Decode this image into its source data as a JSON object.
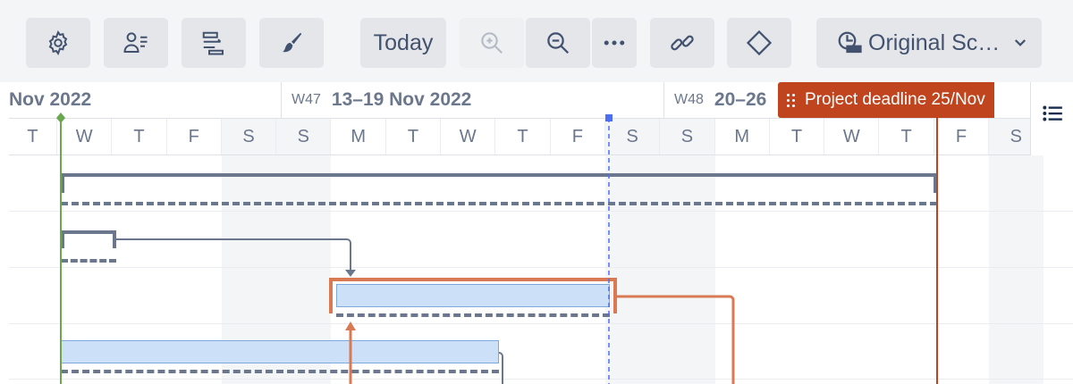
{
  "toolbar": {
    "buttons": [
      {
        "icon": "gear-icon"
      },
      {
        "icon": "user-list-icon"
      },
      {
        "icon": "align-bars-icon"
      },
      {
        "icon": "paint-brush-icon"
      },
      {
        "label": "Today"
      },
      {
        "icon": "zoom-in-icon",
        "disabled": true
      },
      {
        "icon": "zoom-out-icon"
      },
      {
        "icon": "more-icon"
      },
      {
        "icon": "link-icon"
      },
      {
        "icon": "milestone-diamond-icon"
      },
      {
        "label": "Original Sc…",
        "icon": "baseline-icon",
        "dropdown": "chevron-down-icon"
      }
    ]
  },
  "timeline": {
    "weeks": [
      {
        "number": "",
        "label": "Nov 2022"
      },
      {
        "number": "W47",
        "label": "13–19 Nov 2022"
      },
      {
        "number": "W48",
        "label": "20–26"
      }
    ],
    "days": [
      "T",
      "W",
      "T",
      "F",
      "S",
      "S",
      "M",
      "T",
      "W",
      "T",
      "F",
      "S",
      "S",
      "M",
      "T",
      "W",
      "T",
      "F",
      "S"
    ]
  },
  "deadline": {
    "label": "Project deadline 25/Nov",
    "color": "#c0441e"
  },
  "colors": {
    "accent_green": "#6aa84f",
    "deadline_orange": "#c0441e",
    "dependency_orange": "#d97a54",
    "today_blue": "#4c6ef5",
    "bar_blue": "#cce0f8"
  },
  "side_panel": {
    "icon": "list-icon"
  }
}
